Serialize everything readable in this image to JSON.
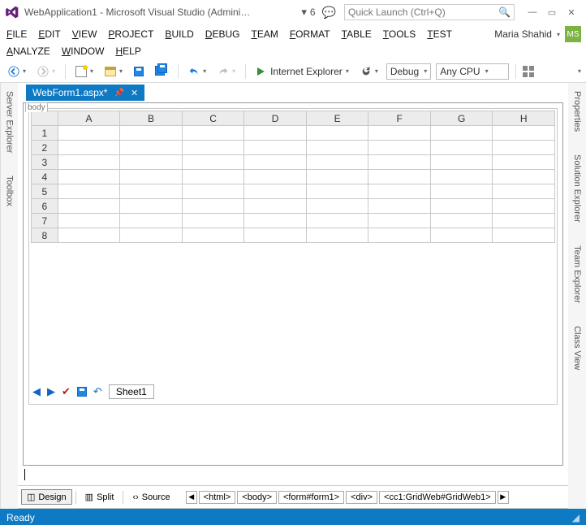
{
  "title": "WebApplication1 - Microsoft Visual Studio (Administra...",
  "notification_count": "6",
  "quick_launch_placeholder": "Quick Launch (Ctrl+Q)",
  "menus_row1": [
    "FILE",
    "EDIT",
    "VIEW",
    "PROJECT",
    "BUILD",
    "DEBUG",
    "TEAM",
    "FORMAT",
    "TABLE",
    "TOOLS",
    "TEST"
  ],
  "menus_row2": [
    "ANALYZE",
    "WINDOW",
    "HELP"
  ],
  "user_name": "Maria Shahid",
  "user_initials": "MS",
  "toolbar": {
    "run_target": "Internet Explorer",
    "config": "Debug",
    "platform": "Any CPU"
  },
  "left_tabs": [
    "Server Explorer",
    "Toolbox"
  ],
  "right_tabs": [
    "Properties",
    "Solution Explorer",
    "Team Explorer",
    "Class View"
  ],
  "document_tab": "WebForm1.aspx*",
  "body_tag_hint": "body",
  "grid": {
    "columns": [
      "A",
      "B",
      "C",
      "D",
      "E",
      "F",
      "G",
      "H"
    ],
    "rows": [
      "1",
      "2",
      "3",
      "4",
      "5",
      "6",
      "7",
      "8"
    ],
    "sheet_name": "Sheet1"
  },
  "views": {
    "design": "Design",
    "split": "Split",
    "source": "Source"
  },
  "breadcrumbs": [
    "<html>",
    "<body>",
    "<form#form1>",
    "<div>",
    "<cc1:GridWeb#GridWeb1>"
  ],
  "status": "Ready"
}
